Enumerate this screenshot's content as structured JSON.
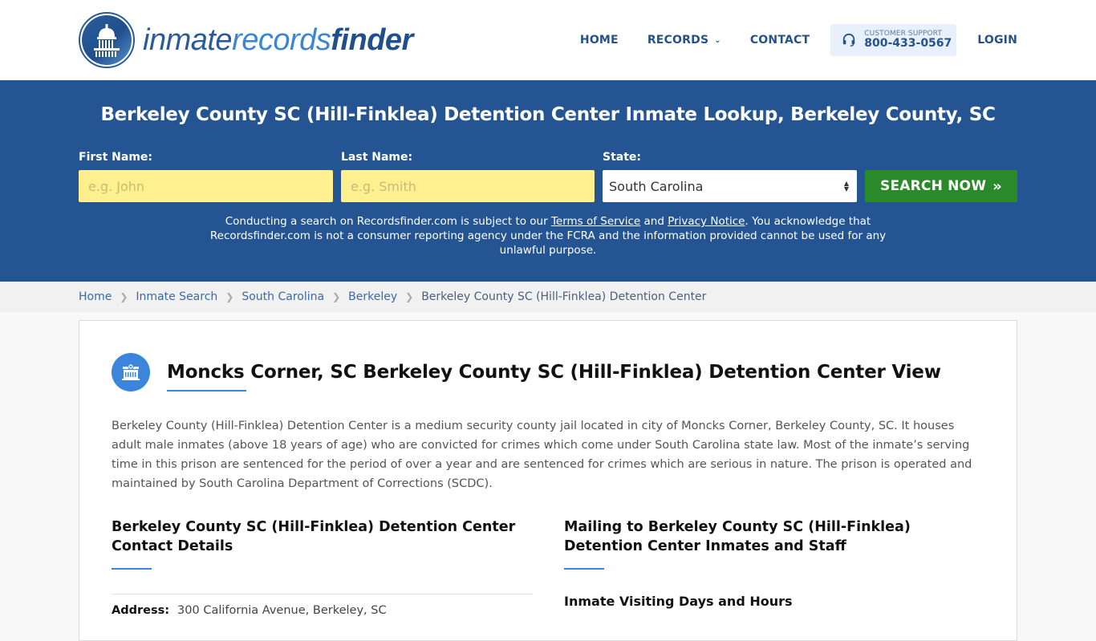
{
  "header": {
    "logo": {
      "part1": "inmate",
      "part2": "records",
      "part3": "finder"
    },
    "nav": {
      "home": "HOME",
      "records": "RECORDS",
      "contact": "CONTACT",
      "support_label": "CUSTOMER SUPPORT",
      "support_phone": "800-433-0567",
      "login": "LOGIN"
    }
  },
  "hero": {
    "title": "Berkeley County SC (Hill-Finklea) Detention Center Inmate Lookup, Berkeley County, SC",
    "form": {
      "first_name_label": "First Name:",
      "first_name_placeholder": "e.g. John",
      "first_name_value": "",
      "last_name_label": "Last Name:",
      "last_name_placeholder": "e.g. Smith",
      "last_name_value": "",
      "state_label": "State:",
      "state_value": "South Carolina",
      "search_button": "SEARCH NOW"
    },
    "disclaimer": {
      "part1": "Conducting a search on Recordsfinder.com is subject to our ",
      "terms_link": "Terms of Service",
      "part2": " and ",
      "privacy_link": "Privacy Notice",
      "part3": ". You acknowledge that Recordsfinder.com is not a consumer reporting agency under the FCRA and the information provided cannot be used for any unlawful purpose."
    }
  },
  "breadcrumb": [
    {
      "label": "Home"
    },
    {
      "label": "Inmate Search"
    },
    {
      "label": "South Carolina"
    },
    {
      "label": "Berkeley"
    },
    {
      "label": "Berkeley County SC (Hill-Finklea) Detention Center"
    }
  ],
  "main": {
    "title": "Moncks Corner, SC Berkeley County SC (Hill-Finklea) Detention Center View",
    "description": "Berkeley County (Hill-Finklea) Detention Center is a medium security county jail located in city of Moncks Corner, Berkeley County, SC. It houses adult male inmates (above 18 years of age) who are convicted for crimes which come under South Carolina state law. Most of the inmate’s serving time in this prison are sentenced for the period of over a year and are sentenced for crimes which are serious in nature. The prison is operated and maintained by South Carolina Department of Corrections (SCDC).",
    "contact": {
      "heading": "Berkeley County SC (Hill-Finklea) Detention Center Contact Details",
      "address_label": "Address:",
      "address_value": "300 California Avenue, Berkeley, SC"
    },
    "mailing": {
      "heading": "Mailing to Berkeley County SC (Hill-Finklea) Detention Center Inmates and Staff",
      "subheading": "Inmate Visiting Days and Hours"
    }
  },
  "colors": {
    "brand_blue": "#245592",
    "accent_blue": "#3b86db",
    "search_green": "#2a8a2a",
    "input_yellow": "#fff08f"
  }
}
